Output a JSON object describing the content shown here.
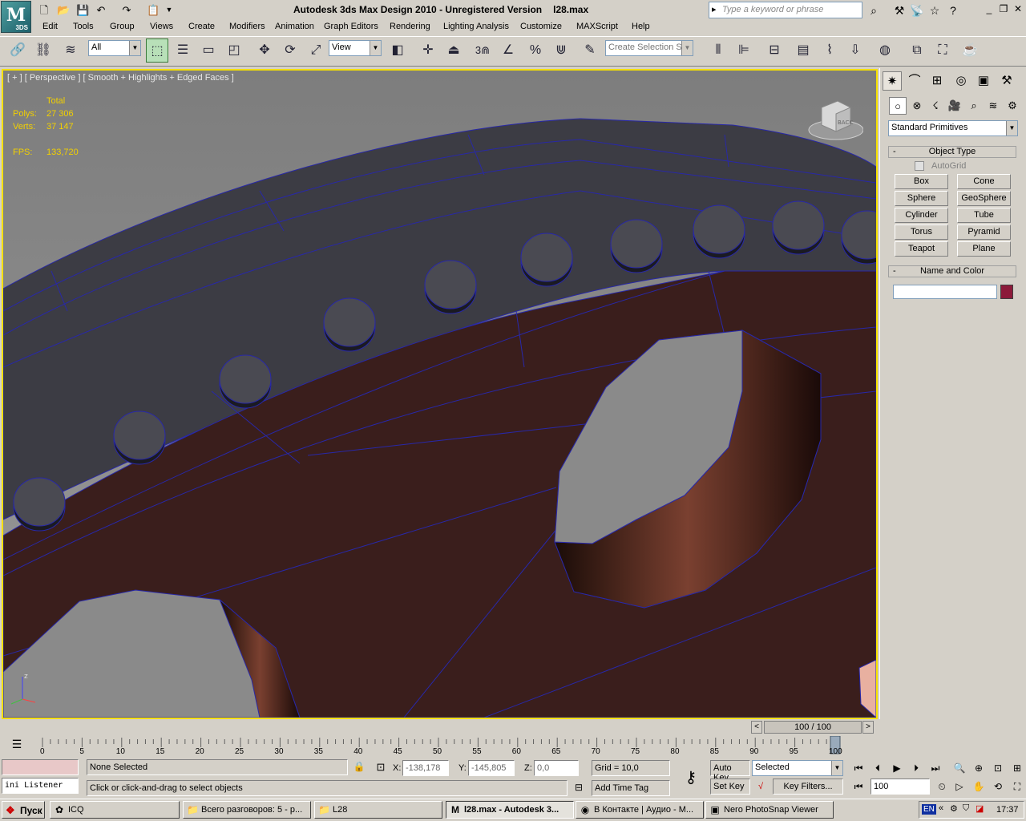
{
  "app": {
    "title": "Autodesk 3ds Max Design 2010",
    "version_note": "Unregistered Version",
    "file": "l28.max",
    "logo": "M",
    "logo_sub": "3DS"
  },
  "search": {
    "placeholder": "Type a keyword or phrase"
  },
  "menu": [
    "Edit",
    "Tools",
    "Group",
    "Views",
    "Create",
    "Modifiers",
    "Animation",
    "Graph Editors",
    "Rendering",
    "Lighting Analysis",
    "Customize",
    "MAXScript",
    "Help"
  ],
  "toolbar": {
    "filter": "All",
    "refcoord": "View",
    "selection_set_placeholder": "Create Selection Se",
    "snap_label": "3"
  },
  "viewport": {
    "label": "[ + ] [ Perspective ] [ Smooth + Highlights + Edged Faces ]",
    "stats": {
      "total_label": "Total",
      "polys_label": "Polys:",
      "polys": "27 306",
      "verts_label": "Verts:",
      "verts": "37 147",
      "fps_label": "FPS:",
      "fps": "133,720"
    },
    "viewcube_face": "BACK",
    "axis_label": "z"
  },
  "cmd": {
    "dropdown": "Standard Primitives",
    "object_type": "Object Type",
    "autogrid": "AutoGrid",
    "buttons": [
      "Box",
      "Cone",
      "Sphere",
      "GeoSphere",
      "Cylinder",
      "Tube",
      "Torus",
      "Pyramid",
      "Teapot",
      "Plane"
    ],
    "name_color": "Name and Color",
    "name_value": "",
    "object_color": "#8c1a3a"
  },
  "time": {
    "frame": "100 / 100",
    "ticks": [
      "0",
      "5",
      "10",
      "15",
      "20",
      "25",
      "30",
      "35",
      "40",
      "45",
      "50",
      "55",
      "60",
      "65",
      "70",
      "75",
      "80",
      "85",
      "90",
      "95",
      "100"
    ]
  },
  "status": {
    "listener": "ini Listener",
    "selected": "None Selected",
    "prompt": "Click or click-and-drag to select objects",
    "x_label": "X:",
    "x": "-138,178",
    "y_label": "Y:",
    "y": "-145,805",
    "z_label": "Z:",
    "z": "0,0",
    "grid": "Grid = 10,0",
    "add_time_tag": "Add Time Tag",
    "auto_key": "Auto Key",
    "set_key": "Set Key",
    "key_mode": "Selected",
    "key_filters": "Key Filters...",
    "frame_value": "100"
  },
  "taskbar": {
    "start": "Пуск",
    "tasks": [
      "ICQ",
      "Всего разговоров: 5 - р...",
      "L28",
      "l28.max - Autodesk 3...",
      "В Контакте | Аудио - M...",
      "Nero PhotoSnap Viewer"
    ],
    "lang": "EN",
    "clock": "17:37"
  }
}
